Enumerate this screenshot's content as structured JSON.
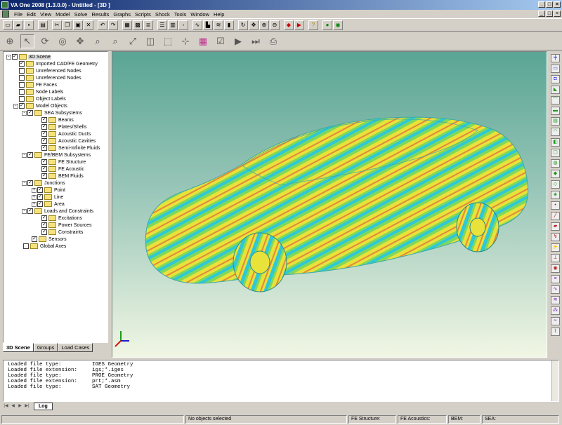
{
  "window": {
    "title": "VA One 2008 (1.3.0.0) - Untitled - [3D ]"
  },
  "menu": [
    "File",
    "Edit",
    "View",
    "Model",
    "Solve",
    "Results",
    "Graphs",
    "Scripts",
    "Shock",
    "Tools",
    "Window",
    "Help"
  ],
  "tree": {
    "items": [
      {
        "label": "3D Scene",
        "checked": true,
        "expander": "-",
        "selected": true
      },
      {
        "label": "Imported CAD/FE Geometry",
        "checked": true
      },
      {
        "label": "Unreferenced Nodes",
        "checked": false
      },
      {
        "label": "Unreferenced Nodes",
        "checked": false
      },
      {
        "label": "FE Faces",
        "checked": false
      },
      {
        "label": "Node Labels",
        "checked": false
      },
      {
        "label": "Object Labels",
        "checked": false
      },
      {
        "label": "Model Objects",
        "checked": true,
        "expander": "-"
      },
      {
        "label": "SEA Subsystems",
        "checked": true,
        "expander": "-"
      },
      {
        "label": "Beams",
        "checked": true
      },
      {
        "label": "Plates/Shells",
        "checked": true
      },
      {
        "label": "Acoustic Ducts",
        "checked": true
      },
      {
        "label": "Acoustic Cavities",
        "checked": true
      },
      {
        "label": "Semi-Infinite Fluids",
        "checked": true
      },
      {
        "label": "FE/BEM Subsystems",
        "checked": true,
        "expander": "-"
      },
      {
        "label": "FE Structure",
        "checked": true
      },
      {
        "label": "FE Acoustic",
        "checked": true
      },
      {
        "label": "BEM Fluids",
        "checked": true
      },
      {
        "label": "Junctions",
        "checked": true,
        "expander": "-"
      },
      {
        "label": "Point",
        "checked": true,
        "expander": "+"
      },
      {
        "label": "Line",
        "checked": true,
        "expander": "+"
      },
      {
        "label": "Area",
        "checked": true,
        "expander": "+"
      },
      {
        "label": "Loads and Constraints",
        "checked": true,
        "expander": "-"
      },
      {
        "label": "Excitations",
        "checked": true
      },
      {
        "label": "Power Sources",
        "checked": true
      },
      {
        "label": "Constraints",
        "checked": true
      },
      {
        "label": "Sensors",
        "checked": true
      },
      {
        "label": "Global Axes",
        "checked": false
      }
    ],
    "tabs": [
      "3D Scene",
      "Groups",
      "Load Cases"
    ]
  },
  "log": {
    "lines": [
      {
        "key": "Loaded file type:",
        "value": "IGES Geometry"
      },
      {
        "key": "Loaded file extension:",
        "value": "igs;*.iges"
      },
      {
        "key": "Loaded file type:",
        "value": "PROE Geometry"
      },
      {
        "key": "Loaded file extension:",
        "value": "prt;*.asm"
      },
      {
        "key": "Loaded file type:",
        "value": "SAT Geometry"
      }
    ],
    "tab": "Log"
  },
  "status": {
    "message": "No objects selected",
    "fe_structure": "FE Structure:",
    "fe_acoustics": "FE Acoustics:",
    "bem": "BEM:",
    "sea": "SEA:"
  },
  "colors": {
    "title_start": "#0a246a",
    "viewport_top": "#5aa594",
    "viewport_bottom": "#f1f6e4",
    "band_cyan": "#2ec8d8",
    "band_yellow": "#e8e23a",
    "band_green": "#7fd85a",
    "band_orange": "#e28a3a"
  }
}
